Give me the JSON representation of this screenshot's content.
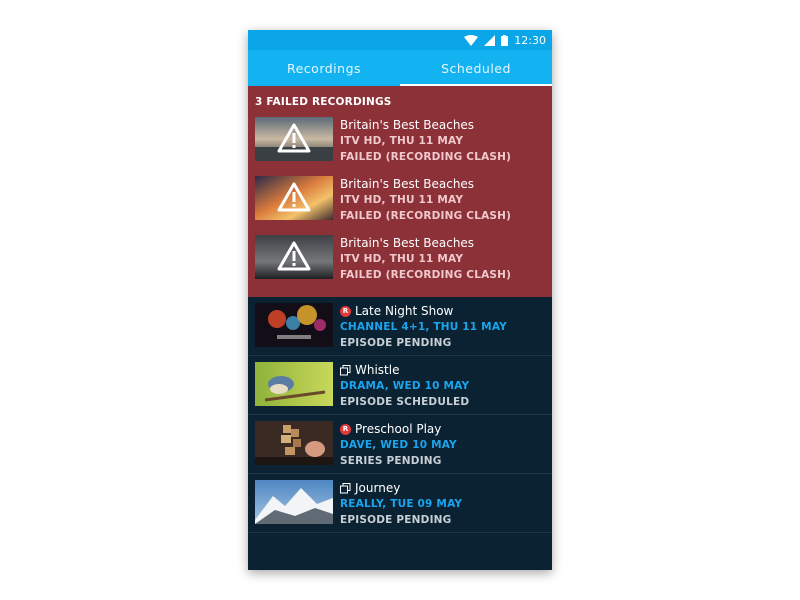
{
  "status_bar": {
    "time": "12:30"
  },
  "tabs": [
    {
      "label": "Recordings",
      "active": false
    },
    {
      "label": "Scheduled",
      "active": true
    }
  ],
  "failed": {
    "header": "3 FAILED RECORDINGS",
    "items": [
      {
        "title": "Britain's Best Beaches",
        "channel": "ITV HD, THU 11 MAY",
        "status": "FAILED (RECORDING CLASH)"
      },
      {
        "title": "Britain's Best Beaches",
        "channel": "ITV HD, THU 11 MAY",
        "status": "FAILED (RECORDING CLASH)"
      },
      {
        "title": "Britain's Best Beaches",
        "channel": "ITV HD, THU 11 MAY",
        "status": "FAILED (RECORDING CLASH)"
      }
    ]
  },
  "scheduled": {
    "items": [
      {
        "icon": "record-icon",
        "title": "Late Night Show",
        "channel": "CHANNEL 4+1, THU 11 MAY",
        "status": "EPISODE PENDING"
      },
      {
        "icon": "series-icon",
        "title": "Whistle",
        "channel": "DRAMA, WED 10 MAY",
        "status": "EPISODE SCHEDULED"
      },
      {
        "icon": "record-icon",
        "title": "Preschool Play",
        "channel": "DAVE, WED 10 MAY",
        "status": "SERIES PENDING"
      },
      {
        "icon": "series-icon",
        "title": "Journey",
        "channel": "REALLY, TUE 09 MAY",
        "status": "EPISODE PENDING"
      }
    ]
  },
  "colors": {
    "accent": "#12b3f0",
    "failed_bg": "#8c3138",
    "list_bg": "#0b2233",
    "channel_text": "#1aa5ee"
  }
}
